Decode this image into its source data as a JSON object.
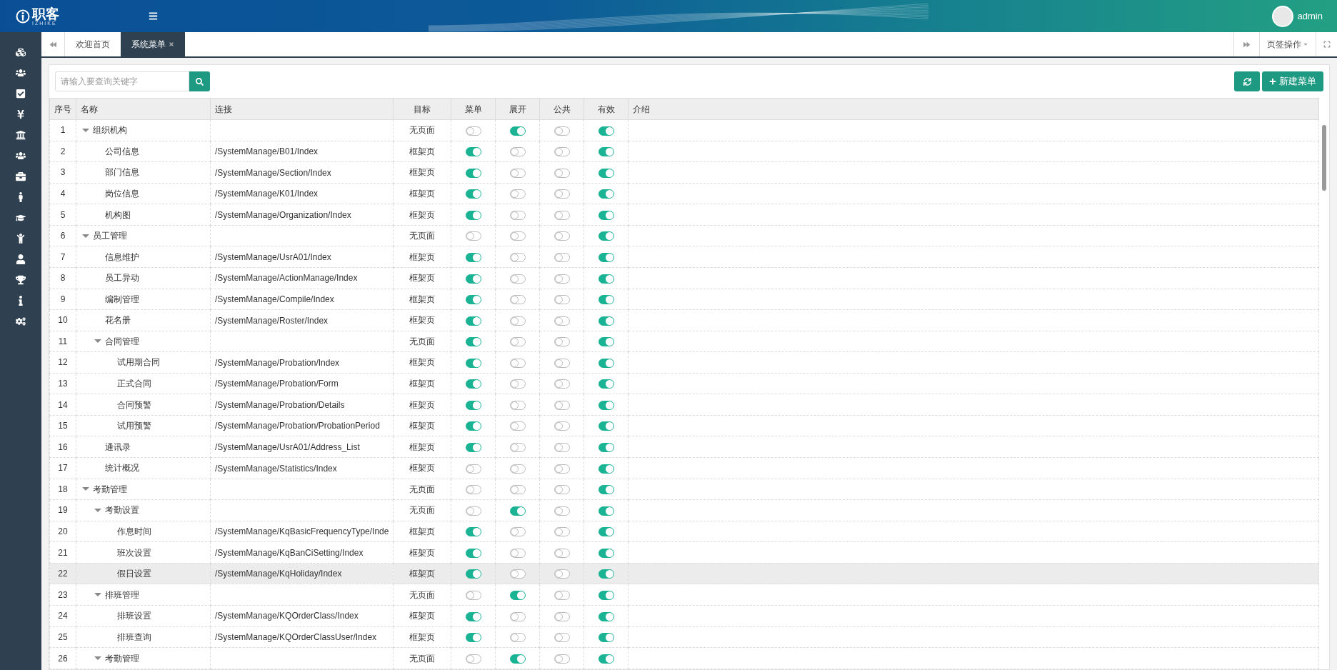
{
  "header": {
    "logo_text": "职客",
    "logo_subtext": "IZHIKE",
    "user": "admin"
  },
  "tabs": [
    {
      "label": "欢迎首页",
      "selected": false,
      "closable": false
    },
    {
      "label": "系统菜单",
      "selected": true,
      "closable": true
    }
  ],
  "tab_actions": {
    "label": "页签操作"
  },
  "toolbar": {
    "search": {
      "placeholder": "请输入要查询关键字"
    },
    "new_button": "新建菜单"
  },
  "table": {
    "columns": [
      "序号",
      "名称",
      "连接",
      "目标",
      "菜单",
      "展开",
      "公共",
      "有效",
      "介绍"
    ],
    "rows": [
      {
        "no": "1",
        "name": "组织机构",
        "kind": "group",
        "expanded": true,
        "target": "无页面",
        "menu": false,
        "expand": true,
        "public": false,
        "valid": true,
        "hovered": false,
        "children": [
          {
            "no": "2",
            "name": "公司信息",
            "kind": "page",
            "link": "/SystemManage/B01/Index",
            "target": "框架页",
            "menu": true,
            "expand": false,
            "public": false,
            "valid": true,
            "hovered": false
          },
          {
            "no": "3",
            "name": "部门信息",
            "kind": "page",
            "link": "/SystemManage/Section/Index",
            "target": "框架页",
            "menu": true,
            "expand": false,
            "public": false,
            "valid": true,
            "hovered": false
          },
          {
            "no": "4",
            "name": "岗位信息",
            "kind": "page",
            "link": "/SystemManage/K01/Index",
            "target": "框架页",
            "menu": true,
            "expand": false,
            "public": false,
            "valid": true,
            "hovered": false
          },
          {
            "no": "5",
            "name": "机构图",
            "kind": "page",
            "link": "/SystemManage/Organization/Index",
            "target": "框架页",
            "menu": true,
            "expand": false,
            "public": false,
            "valid": true,
            "hovered": false
          }
        ]
      },
      {
        "no": "6",
        "name": "员工管理",
        "kind": "group",
        "expanded": true,
        "target": "无页面",
        "menu": false,
        "expand": false,
        "public": false,
        "valid": true,
        "hovered": false,
        "children": [
          {
            "no": "7",
            "name": "信息维护",
            "kind": "page",
            "link": "/SystemManage/UsrA01/Index",
            "target": "框架页",
            "menu": true,
            "expand": false,
            "public": false,
            "valid": true,
            "hovered": false
          },
          {
            "no": "8",
            "name": "员工异动",
            "kind": "page",
            "link": "/SystemManage/ActionManage/Index",
            "target": "框架页",
            "menu": true,
            "expand": false,
            "public": false,
            "valid": true,
            "hovered": false
          },
          {
            "no": "9",
            "name": "编制管理",
            "kind": "page",
            "link": "/SystemManage/Compile/Index",
            "target": "框架页",
            "menu": true,
            "expand": false,
            "public": false,
            "valid": true,
            "hovered": false
          },
          {
            "no": "10",
            "name": "花名册",
            "kind": "page",
            "link": "/SystemManage/Roster/Index",
            "target": "框架页",
            "menu": true,
            "expand": false,
            "public": false,
            "valid": true,
            "hovered": false
          },
          {
            "no": "11",
            "name": "合同管理",
            "kind": "group",
            "expanded": true,
            "target": "无页面",
            "menu": true,
            "expand": false,
            "public": false,
            "valid": true,
            "hovered": false,
            "children": [
              {
                "no": "12",
                "name": "试用期合同",
                "kind": "page",
                "link": "/SystemManage/Probation/Index",
                "target": "框架页",
                "menu": true,
                "expand": false,
                "public": false,
                "valid": true,
                "hovered": false
              },
              {
                "no": "13",
                "name": "正式合同",
                "kind": "page",
                "link": "/SystemManage/Probation/Form",
                "target": "框架页",
                "menu": true,
                "expand": false,
                "public": false,
                "valid": true,
                "hovered": false
              },
              {
                "no": "14",
                "name": "合同预警",
                "kind": "page",
                "link": "/SystemManage/Probation/Details",
                "target": "框架页",
                "menu": true,
                "expand": false,
                "public": false,
                "valid": true,
                "hovered": false
              },
              {
                "no": "15",
                "name": "试用预警",
                "kind": "page",
                "link": "/SystemManage/Probation/ProbationPeriod",
                "target": "框架页",
                "menu": true,
                "expand": false,
                "public": false,
                "valid": true,
                "hovered": false
              }
            ]
          },
          {
            "no": "16",
            "name": "通讯录",
            "kind": "page",
            "link": "/SystemManage/UsrA01/Address_List",
            "target": "框架页",
            "menu": true,
            "expand": false,
            "public": false,
            "valid": true,
            "hovered": false
          },
          {
            "no": "17",
            "name": "统计概况",
            "kind": "page",
            "link": "/SystemManage/Statistics/Index",
            "target": "框架页",
            "menu": false,
            "expand": false,
            "public": false,
            "valid": true,
            "hovered": false
          }
        ]
      },
      {
        "no": "18",
        "name": "考勤管理",
        "kind": "group",
        "expanded": true,
        "target": "无页面",
        "menu": false,
        "expand": false,
        "public": false,
        "valid": true,
        "hovered": false,
        "children": [
          {
            "no": "19",
            "name": "考勤设置",
            "kind": "group",
            "expanded": true,
            "target": "无页面",
            "menu": false,
            "expand": true,
            "public": false,
            "valid": true,
            "hovered": false,
            "children": [
              {
                "no": "20",
                "name": "作息时间",
                "kind": "page",
                "link": "/SystemManage/KqBasicFrequencyType/Inde",
                "target": "框架页",
                "menu": true,
                "expand": false,
                "public": false,
                "valid": true,
                "hovered": false
              },
              {
                "no": "21",
                "name": "班次设置",
                "kind": "page",
                "link": "/SystemManage/KqBanCiSetting/Index",
                "target": "框架页",
                "menu": true,
                "expand": false,
                "public": false,
                "valid": true,
                "hovered": false
              },
              {
                "no": "22",
                "name": "假日设置",
                "kind": "page",
                "link": "/SystemManage/KqHoliday/Index",
                "target": "框架页",
                "menu": true,
                "expand": false,
                "public": false,
                "valid": true,
                "hovered": true
              }
            ]
          },
          {
            "no": "23",
            "name": "排班管理",
            "kind": "group",
            "expanded": true,
            "target": "无页面",
            "menu": false,
            "expand": true,
            "public": false,
            "valid": true,
            "hovered": false,
            "children": [
              {
                "no": "24",
                "name": "排班设置",
                "kind": "page",
                "link": "/SystemManage/KQOrderClass/Index",
                "target": "框架页",
                "menu": true,
                "expand": false,
                "public": false,
                "valid": true,
                "hovered": false
              },
              {
                "no": "25",
                "name": "排班查询",
                "kind": "page",
                "link": "/SystemManage/KQOrderClassUser/Index",
                "target": "框架页",
                "menu": true,
                "expand": false,
                "public": false,
                "valid": true,
                "hovered": false
              }
            ]
          },
          {
            "no": "26",
            "name": "考勤管理",
            "kind": "group",
            "expanded": true,
            "target": "无页面",
            "menu": false,
            "expand": true,
            "public": false,
            "valid": true,
            "hovered": false
          }
        ]
      }
    ]
  }
}
